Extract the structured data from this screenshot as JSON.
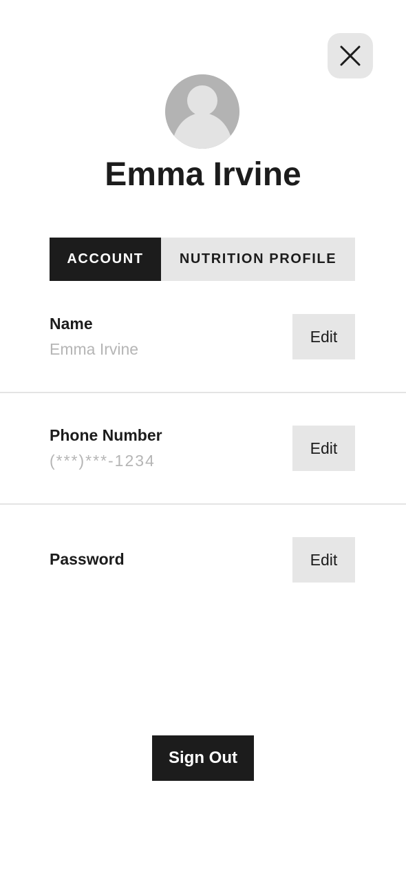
{
  "header": {
    "close_icon": "close-icon",
    "avatar_icon": "user-avatar-placeholder"
  },
  "user": {
    "name": "Emma Irvine"
  },
  "tabs": [
    {
      "label": "ACCOUNT",
      "active": true
    },
    {
      "label": "NUTRITION PROFILE",
      "active": false
    }
  ],
  "account": {
    "name_row": {
      "label": "Name",
      "value": "Emma Irvine",
      "edit_label": "Edit"
    },
    "phone_row": {
      "label": "Phone Number",
      "value": "(***)***-1234",
      "edit_label": "Edit"
    },
    "password_row": {
      "label": "Password",
      "edit_label": "Edit"
    }
  },
  "footer": {
    "sign_out_label": "Sign Out"
  },
  "colors": {
    "primary_dark": "#1c1c1c",
    "light_gray": "#e6e6e6",
    "muted_text": "#b5b5b5",
    "avatar_bg": "#b3b3b3",
    "divider": "#e4e4e4"
  }
}
